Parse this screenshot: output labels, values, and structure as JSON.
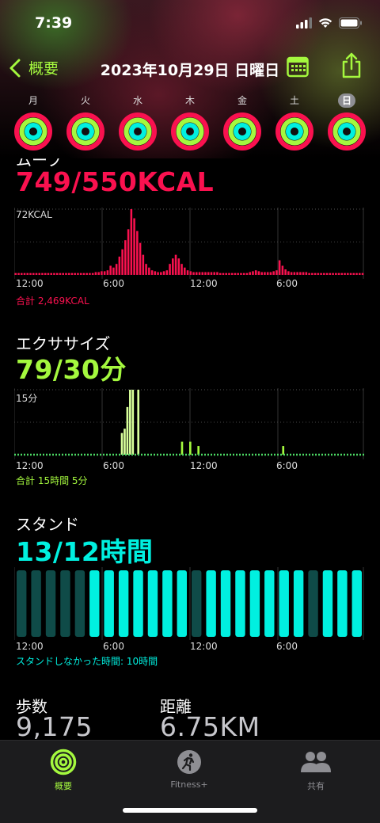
{
  "status": {
    "time": "7:39"
  },
  "nav": {
    "back_label": "概要",
    "title": "2023年10月29日 日曜日"
  },
  "week": [
    {
      "label": "月",
      "selected": false
    },
    {
      "label": "火",
      "selected": false
    },
    {
      "label": "水",
      "selected": false
    },
    {
      "label": "木",
      "selected": false
    },
    {
      "label": "金",
      "selected": false
    },
    {
      "label": "土",
      "selected": false
    },
    {
      "label": "日",
      "selected": true
    }
  ],
  "colors": {
    "move": "#fa114f",
    "exercise": "#a4f83e",
    "stand": "#00f0e0",
    "accent": "#a4f83e"
  },
  "move": {
    "title": "ムーブ",
    "value": "749/550KCAL",
    "max_label": "72KCAL",
    "total": "合計 2,469KCAL",
    "x_ticks": [
      "12:00",
      "6:00",
      "12:00",
      "6:00"
    ],
    "chart_data": {
      "type": "bar",
      "ylim": [
        0,
        72
      ],
      "values": [
        2,
        2,
        2,
        2,
        2,
        2,
        2,
        2,
        2,
        2,
        2,
        2,
        2,
        2,
        2,
        2,
        2,
        2,
        2,
        2,
        2,
        2,
        2,
        2,
        2,
        2,
        2,
        3,
        3,
        4,
        4,
        5,
        10,
        8,
        12,
        20,
        28,
        38,
        50,
        72,
        62,
        48,
        35,
        22,
        12,
        8,
        5,
        4,
        3,
        3,
        4,
        5,
        12,
        18,
        22,
        18,
        12,
        8,
        5,
        4,
        3,
        3,
        3,
        3,
        3,
        3,
        3,
        3,
        3,
        2,
        2,
        2,
        2,
        2,
        2,
        2,
        2,
        2,
        2,
        3,
        4,
        5,
        4,
        3,
        3,
        3,
        3,
        4,
        5,
        16,
        10,
        6,
        4,
        3,
        3,
        3,
        3,
        3,
        3,
        2,
        2,
        2,
        2,
        2,
        2,
        2,
        2,
        2,
        2,
        2,
        2,
        2,
        2,
        2,
        2,
        2,
        2,
        2
      ]
    }
  },
  "exercise": {
    "title": "エクササイズ",
    "value": "79/30分",
    "max_label": "15分",
    "total": "合計 15時間 5分",
    "x_ticks": [
      "12:00",
      "6:00",
      "12:00",
      "6:00"
    ],
    "chart_data": {
      "type": "bar",
      "ylim": [
        0,
        15
      ],
      "values": [
        0,
        0,
        0,
        0,
        0,
        0,
        0,
        0,
        0,
        0,
        0,
        0,
        0,
        0,
        0,
        0,
        0,
        0,
        0,
        0,
        0,
        0,
        0,
        0,
        0,
        0,
        0,
        0,
        0,
        0,
        0,
        0,
        0,
        0,
        0,
        0,
        0,
        0,
        0,
        5,
        6,
        11,
        15,
        15,
        0,
        15,
        0,
        0,
        0,
        0,
        0,
        0,
        0,
        0,
        0,
        0,
        0,
        0,
        0,
        0,
        0,
        3,
        0,
        0,
        3,
        0,
        0,
        2,
        0,
        0,
        0,
        0,
        0,
        0,
        0,
        0,
        0,
        0,
        0,
        0,
        0,
        0,
        0,
        0,
        0,
        0,
        0,
        0,
        0,
        0,
        0,
        0,
        0,
        0,
        0,
        0,
        0,
        0,
        2,
        0,
        0,
        0,
        0,
        0,
        0,
        0,
        0,
        0,
        0,
        0,
        0,
        0,
        0,
        0,
        0,
        0,
        0,
        0,
        0,
        0,
        0,
        0,
        0,
        0,
        0,
        0,
        0,
        0
      ]
    }
  },
  "stand": {
    "title": "スタンド",
    "value": "13/12時間",
    "missed": "スタンドしなかった時間: 10時間",
    "x_ticks": [
      "12:00",
      "6:00",
      "12:00",
      "6:00"
    ],
    "chart_data": {
      "type": "bar",
      "hours": [
        0,
        0,
        0,
        0,
        0,
        1,
        1,
        1,
        1,
        1,
        1,
        1,
        0,
        1,
        1,
        1,
        1,
        1,
        1,
        1,
        0,
        1,
        1,
        1
      ]
    }
  },
  "stats": {
    "steps_label": "歩数",
    "steps_value": "9,175",
    "distance_label": "距離",
    "distance_value": "6.75KM"
  },
  "tabs": [
    {
      "label": "概要",
      "active": true
    },
    {
      "label": "Fitness+",
      "active": false
    },
    {
      "label": "共有",
      "active": false
    }
  ]
}
